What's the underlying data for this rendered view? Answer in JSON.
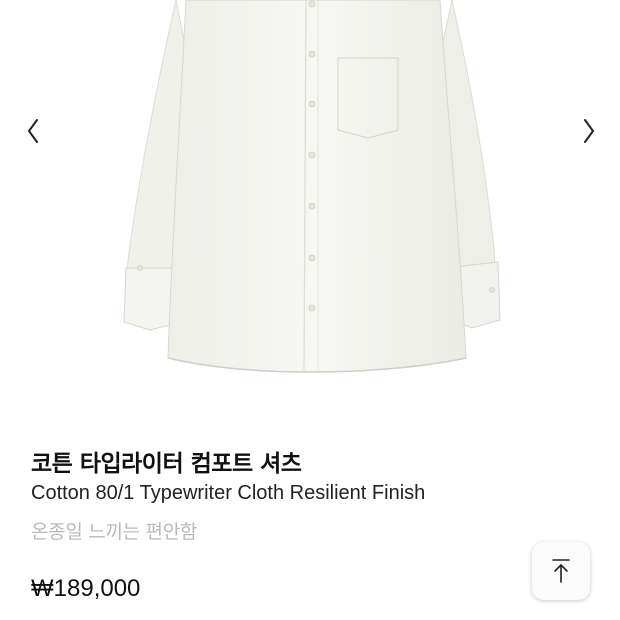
{
  "gallery": {
    "prev_icon": "chevron-left-icon",
    "next_icon": "chevron-right-icon"
  },
  "product": {
    "name_ko": "코튼 타입라이터 컴포트 셔츠",
    "name_en": "Cotton 80/1 Typewriter Cloth Resilient Finish",
    "subtitle": "온종일 느끼는 편안함",
    "price": "₩189,000"
  },
  "scroll_top": {
    "icon": "arrow-up-to-top-icon"
  },
  "colors": {
    "text_primary": "#111111",
    "text_muted": "#b9b9b9",
    "background": "#ffffff"
  }
}
